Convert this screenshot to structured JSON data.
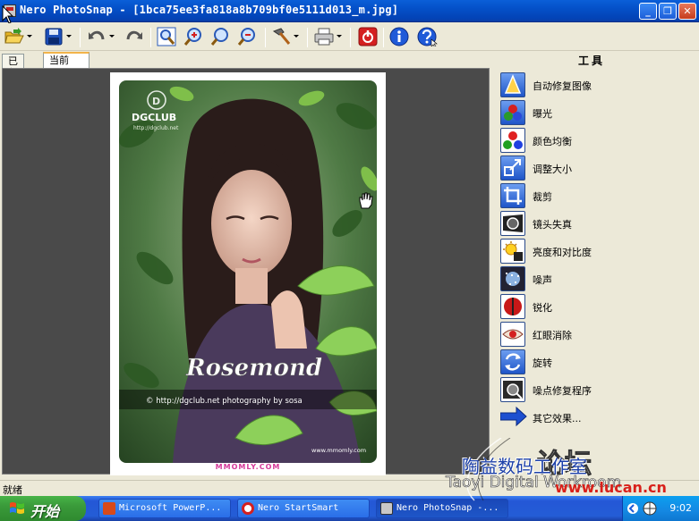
{
  "window": {
    "title": "Nero PhotoSnap - [1bca75ee3fa818a8b709bf0e5111d013_m.jpg]",
    "minimize_label": "_",
    "restore_label": "❐",
    "close_label": "✕"
  },
  "toolbar": {
    "buttons": [
      {
        "name": "open",
        "icon": "folder-open-icon",
        "dropdown": true
      },
      {
        "name": "save",
        "icon": "floppy-save-icon",
        "dropdown": true
      },
      {
        "name": "undo",
        "icon": "undo-icon",
        "dropdown": true
      },
      {
        "name": "redo",
        "icon": "redo-icon"
      },
      {
        "name": "zoom-fit",
        "icon": "zoom-fit-icon"
      },
      {
        "name": "zoom-in",
        "icon": "zoom-in-icon"
      },
      {
        "name": "zoom-100",
        "icon": "zoom-actual-icon"
      },
      {
        "name": "zoom-out",
        "icon": "zoom-out-icon"
      },
      {
        "name": "tools",
        "icon": "hammer-icon",
        "dropdown": true
      },
      {
        "name": "print",
        "icon": "printer-icon",
        "dropdown": true
      },
      {
        "name": "exit",
        "icon": "power-icon"
      },
      {
        "name": "info",
        "icon": "info-icon"
      },
      {
        "name": "help",
        "icon": "help-icon"
      }
    ]
  },
  "tabs": [
    {
      "label": "已保存",
      "active": false
    },
    {
      "label": "当前",
      "active": true
    }
  ],
  "image": {
    "logo_text": "DGCLUB",
    "logo_subtext": "http://dgclub.net",
    "caption": "Rosemond",
    "credit": "© http://dgclub.net  photography by sosa",
    "corner_mark": "www.mmomly.com",
    "footer": "MMOMLY.COM"
  },
  "tools_panel": {
    "header": "工具",
    "items": [
      {
        "label": "自动修复图像",
        "icon": "auto-fix-icon"
      },
      {
        "label": "曝光",
        "icon": "exposure-icon"
      },
      {
        "label": "颜色均衡",
        "icon": "color-balance-icon"
      },
      {
        "label": "调整大小",
        "icon": "resize-icon"
      },
      {
        "label": "裁剪",
        "icon": "crop-icon"
      },
      {
        "label": "镜头失真",
        "icon": "lens-distortion-icon"
      },
      {
        "label": "亮度和对比度",
        "icon": "brightness-contrast-icon"
      },
      {
        "label": "噪声",
        "icon": "noise-icon"
      },
      {
        "label": "锐化",
        "icon": "sharpen-icon"
      },
      {
        "label": "红眼消除",
        "icon": "red-eye-icon"
      },
      {
        "label": "旋转",
        "icon": "rotate-icon"
      },
      {
        "label": "噪点修复程序",
        "icon": "noise-repair-icon"
      },
      {
        "label": "其它效果...",
        "icon": "arrow-right-icon"
      }
    ]
  },
  "status": {
    "text": "就绪"
  },
  "taskbar": {
    "start_label": "开始",
    "tasks": [
      {
        "label": "Microsoft PowerP...",
        "icon": "powerpoint-icon",
        "active": false
      },
      {
        "label": "Nero StartSmart",
        "icon": "nero-icon",
        "active": false
      },
      {
        "label": "Nero PhotoSnap -...",
        "icon": "photosnap-icon",
        "active": true
      }
    ],
    "clock": "9:02"
  },
  "watermark": {
    "chinese": "陶益数码工作室",
    "big": "论坛",
    "english": "Taoyi Digital Workroom",
    "url": "www.lucan.cn"
  }
}
